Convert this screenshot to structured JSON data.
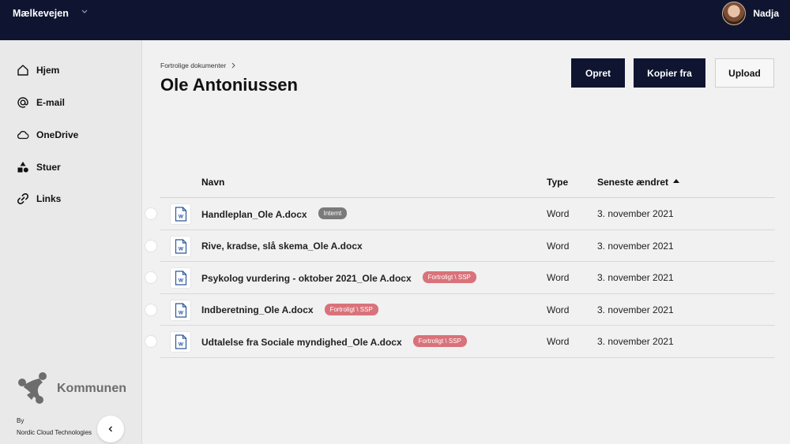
{
  "header": {
    "org_name": "Mælkevejen",
    "user_name": "Nadja"
  },
  "sidebar": {
    "items": [
      {
        "label": "Hjem",
        "icon": "home-icon"
      },
      {
        "label": "E-mail",
        "icon": "at-icon"
      },
      {
        "label": "OneDrive",
        "icon": "cloud-icon"
      },
      {
        "label": "Stuer",
        "icon": "shapes-icon"
      },
      {
        "label": "Links",
        "icon": "link-icon"
      }
    ],
    "logo_text": "Kommunen",
    "by_label": "By",
    "maker": "Nordic Cloud Technologies"
  },
  "main": {
    "breadcrumb": "Fortrolige dokumenter",
    "title": "Ole Antoniussen",
    "buttons": {
      "create": "Opret",
      "copy_from": "Kopier fra",
      "upload": "Upload"
    },
    "table": {
      "columns": {
        "name": "Navn",
        "type": "Type",
        "modified": "Seneste ændret"
      },
      "rows": [
        {
          "name": "Handleplan_Ole A.docx",
          "badge": "Internt",
          "badge_color": "#7a7a7a",
          "type": "Word",
          "date": "3. november 2021"
        },
        {
          "name": "Rive, kradse, slå skema_Ole A.docx",
          "badge": "",
          "badge_color": "",
          "type": "Word",
          "date": "3. november 2021"
        },
        {
          "name": "Psykolog vurdering - oktober 2021_Ole A.docx",
          "badge": "Fortroligt \\ SSP",
          "badge_color": "#d9727a",
          "type": "Word",
          "date": "3. november 2021"
        },
        {
          "name": "Indberetning_Ole A.docx",
          "badge": "Fortroligt \\ SSP",
          "badge_color": "#d9727a",
          "type": "Word",
          "date": "3. november 2021"
        },
        {
          "name": "Udtalelse fra Sociale myndighed_Ole A.docx",
          "badge": "Fortroligt \\ SSP",
          "badge_color": "#d9727a",
          "type": "Word",
          "date": "3. november 2021"
        }
      ]
    }
  },
  "colors": {
    "topbar": "#0f1530",
    "button_dark": "#0f1530",
    "word_blue": "#2b579a"
  }
}
